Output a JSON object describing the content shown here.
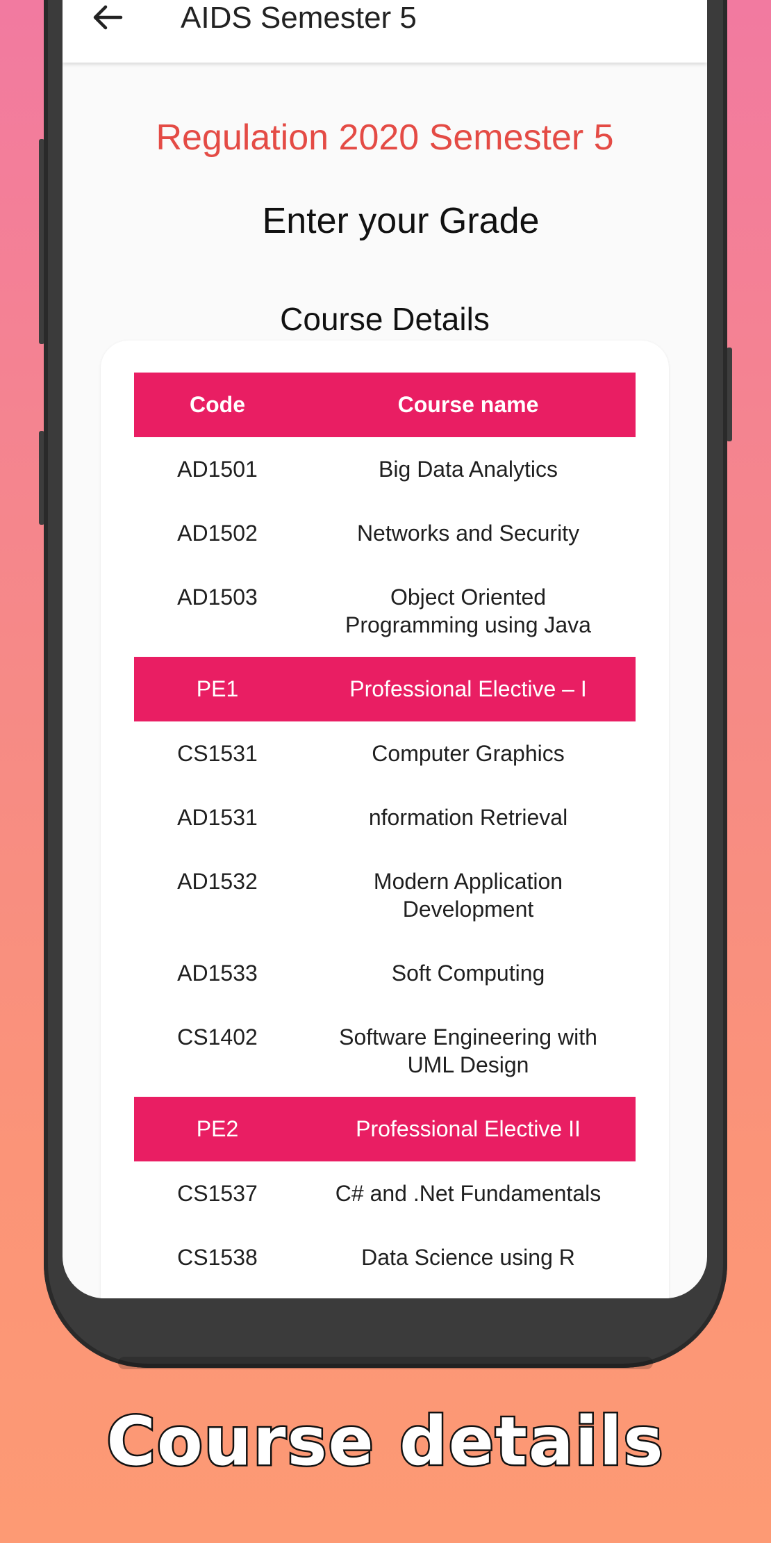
{
  "appbar": {
    "title": "AIDS Semester 5"
  },
  "headings": {
    "regulation": "Regulation 2020 Semester 5",
    "enter_grade": "Enter your Grade",
    "course_details": "Course Details"
  },
  "table": {
    "header": {
      "code": "Code",
      "name": "Course name"
    },
    "core": [
      {
        "code": "AD1501",
        "name": "Big Data Analytics"
      },
      {
        "code": "AD1502",
        "name": "Networks and Security"
      },
      {
        "code": "AD1503",
        "name": "Object Oriented Programming using Java"
      }
    ],
    "pe1_header": {
      "code": "PE1",
      "name": "Professional Elective – I"
    },
    "pe1": [
      {
        "code": "CS1531",
        "name": "Computer Graphics"
      },
      {
        "code": "AD1531",
        "name": "nformation Retrieval"
      },
      {
        "code": "AD1532",
        "name": "Modern Application Development"
      },
      {
        "code": "AD1533",
        "name": "Soft Computing"
      },
      {
        "code": "CS1402",
        "name": "Software Engineering with UML Design"
      }
    ],
    "pe2_header": {
      "code": "PE2",
      "name": "Professional Elective II"
    },
    "pe2": [
      {
        "code": "CS1537",
        "name": "C# and .Net Fundamentals"
      },
      {
        "code": "CS1538",
        "name": "Data Science using R"
      }
    ]
  },
  "caption": "Course details",
  "icons": {
    "back": "arrow-left-icon"
  },
  "colors": {
    "accent": "#e91e63",
    "heading_red": "#e44b45"
  }
}
